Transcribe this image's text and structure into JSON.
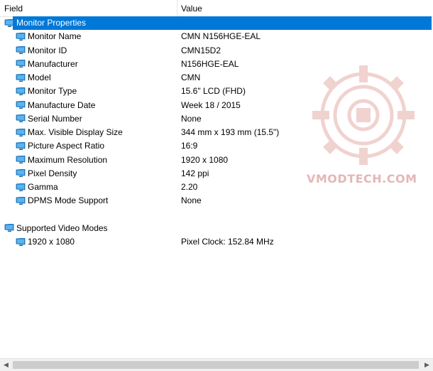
{
  "header": {
    "field_label": "Field",
    "value_label": "Value"
  },
  "groups": [
    {
      "label": "Monitor Properties",
      "selected": true,
      "icon": "monitor-icon",
      "rows": [
        {
          "field": "Monitor Name",
          "value": "CMN N156HGE-EAL"
        },
        {
          "field": "Monitor ID",
          "value": "CMN15D2"
        },
        {
          "field": "Manufacturer",
          "value": "N156HGE-EAL"
        },
        {
          "field": "Model",
          "value": "CMN"
        },
        {
          "field": "Monitor Type",
          "value": "15.6\" LCD (FHD)"
        },
        {
          "field": "Manufacture Date",
          "value": "Week 18 / 2015"
        },
        {
          "field": "Serial Number",
          "value": "None"
        },
        {
          "field": "Max. Visible Display Size",
          "value": "344 mm x 193 mm (15.5\")"
        },
        {
          "field": "Picture Aspect Ratio",
          "value": "16:9"
        },
        {
          "field": "Maximum Resolution",
          "value": "1920 x 1080"
        },
        {
          "field": "Pixel Density",
          "value": "142 ppi"
        },
        {
          "field": "Gamma",
          "value": "2.20"
        },
        {
          "field": "DPMS Mode Support",
          "value": "None"
        }
      ]
    },
    {
      "label": "Supported Video Modes",
      "selected": false,
      "icon": "monitor-icon",
      "rows": [
        {
          "field": "1920 x 1080",
          "value": "Pixel Clock: 152.84 MHz"
        }
      ]
    }
  ],
  "watermark": {
    "text": "VMODTECH.COM"
  },
  "colors": {
    "selection": "#0078d7",
    "icon_blue": "#1e90d6"
  }
}
